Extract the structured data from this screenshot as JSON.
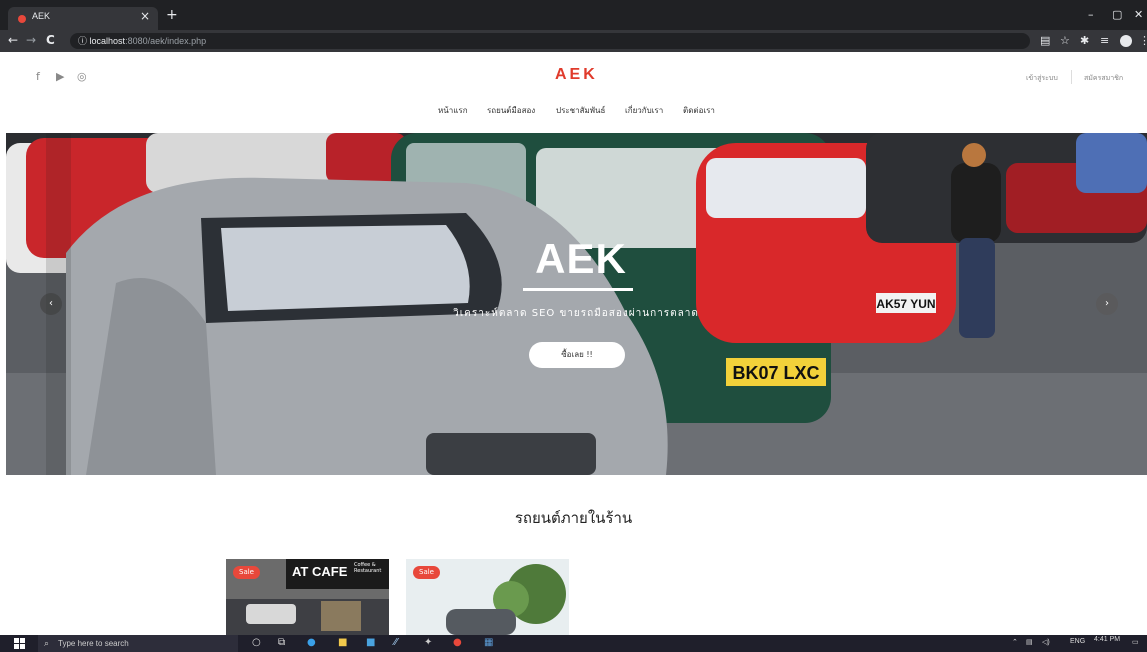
{
  "browser": {
    "tab_title": "AEK",
    "tab_close": "×",
    "new_tab": "+",
    "minimize": "–",
    "maximize": "▢",
    "close": "✕",
    "back": "←",
    "forward": "→",
    "reload": "C",
    "info": "ⓘ",
    "url_host": "localhost",
    "url_path": ":8080/aek/index.php"
  },
  "site": {
    "brand": "AEK",
    "social": [
      "f",
      "▶",
      "◎"
    ],
    "login": "เข้าสู่ระบบ",
    "register": "สมัครสมาชิก",
    "nav": [
      "หน้าแรก",
      "รถยนต์มือสอง",
      "ประชาสัมพันธ์",
      "เกี่ยวกับเรา",
      "ติดต่อเรา"
    ]
  },
  "hero": {
    "title": "AEK",
    "subtitle": "วิเคราะห์ตลาด SEO ขายรถมือสองผ่านการตลาด",
    "button": "ซื้อเลย !!",
    "prev": "‹",
    "next": "›"
  },
  "section": {
    "title": "รถยนต์ภายในร้าน"
  },
  "cards": [
    {
      "badge": "Sale",
      "sign": "AT CAFE",
      "sign_small": "Coffee & Restaurant"
    },
    {
      "badge": "Sale"
    }
  ],
  "taskbar": {
    "search_placeholder": "Type here to search",
    "lang": "ENG",
    "time": "4:41 PM"
  },
  "colors": {
    "brand": "#e03b2c",
    "badge": "#e8483b",
    "taskbar": "#1f1f2b"
  }
}
